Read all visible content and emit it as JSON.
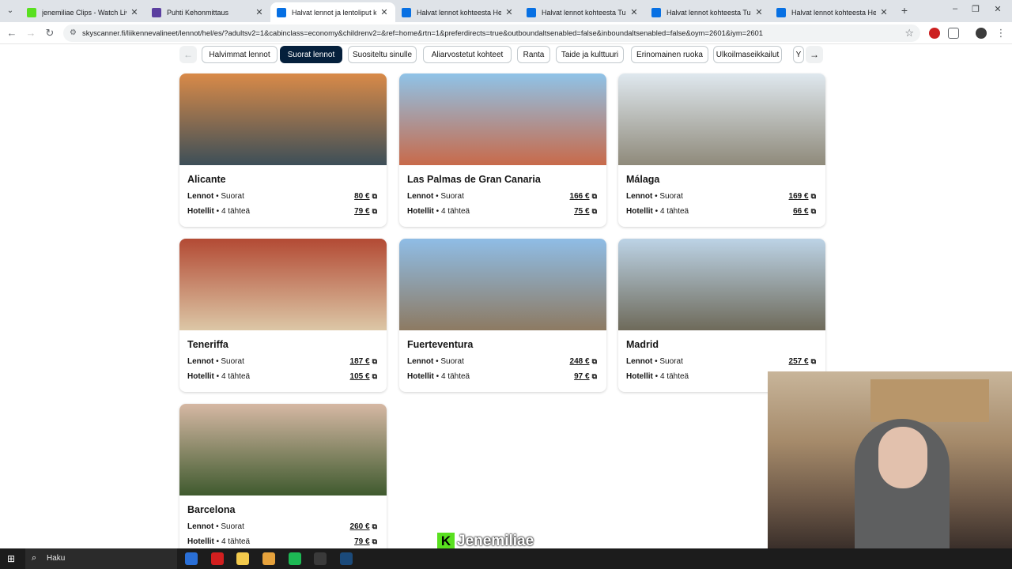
{
  "browser": {
    "tabs": [
      {
        "title": "jenemiliae Clips - Watch Live or",
        "favicon_color": "#59e01f",
        "active": false
      },
      {
        "title": "Puhti Kehonmittaus",
        "favicon_color": "#5b3fa0",
        "active": false
      },
      {
        "title": "Halvat lennot ja lentoliput kaikki",
        "favicon_color": "#0770e3",
        "active": true
      },
      {
        "title": "Halvat lennot kohteesta Helsinki",
        "favicon_color": "#0770e3",
        "active": false
      },
      {
        "title": "Halvat lennot kohteesta Turku (",
        "favicon_color": "#0770e3",
        "active": false
      },
      {
        "title": "Halvat lennot kohteesta Turku (",
        "favicon_color": "#0770e3",
        "active": false
      },
      {
        "title": "Halvat lennot kohteesta Helsinki",
        "favicon_color": "#0770e3",
        "active": false
      }
    ],
    "url": "skyscanner.fi/liikennevalineet/lennot/hel/es/?adultsv2=1&cabinclass=economy&childrenv2=&ref=home&rtn=1&preferdirects=true&outboundaltsenabled=false&inboundaltsenabled=false&oym=2601&iym=2601"
  },
  "filters": {
    "pills": [
      {
        "label": "Halvimmat lennot",
        "active": false
      },
      {
        "label": "Suorat lennot",
        "active": true
      },
      {
        "label": "Suositeltu sinulle",
        "active": false
      },
      {
        "label": "Aliarvostetut kohteet",
        "active": false
      },
      {
        "label": "Ranta",
        "active": false
      },
      {
        "label": "Taide ja kulttuuri",
        "active": false
      },
      {
        "label": "Erinomainen ruoka",
        "active": false
      },
      {
        "label": "Ulkoilmaseikkailut",
        "active": false
      },
      {
        "label": "Y",
        "active": false
      }
    ]
  },
  "common": {
    "flights_label": "Lennot",
    "flights_sub": " • Suorat",
    "hotels_label": "Hotellit",
    "hotels_sub": " • 4 tähteä"
  },
  "destinations": [
    {
      "city": "Alicante",
      "flight_price": "80 €",
      "hotel_price": "79 €",
      "photo_top": "#d98a48",
      "photo_bottom": "#3d4f58"
    },
    {
      "city": "Las Palmas de Gran Canaria",
      "flight_price": "166 €",
      "hotel_price": "75 €",
      "photo_top": "#8fc3e8",
      "photo_bottom": "#c86a4a"
    },
    {
      "city": "Málaga",
      "flight_price": "169 €",
      "hotel_price": "66 €",
      "photo_top": "#dfe8ef",
      "photo_bottom": "#8f8a7b"
    },
    {
      "city": "Teneriffa",
      "flight_price": "187 €",
      "hotel_price": "105 €",
      "photo_top": "#b34a34",
      "photo_bottom": "#dcc7a6"
    },
    {
      "city": "Fuerteventura",
      "flight_price": "248 €",
      "hotel_price": "97 €",
      "photo_top": "#8fbde6",
      "photo_bottom": "#8d7a62"
    },
    {
      "city": "Madrid",
      "flight_price": "257 €",
      "hotel_price": "",
      "photo_top": "#bcd3e6",
      "photo_bottom": "#6e6a5a"
    },
    {
      "city": "Barcelona",
      "flight_price": "260 €",
      "hotel_price": "79 €",
      "photo_top": "#d6b8a4",
      "photo_bottom": "#3f5a2e"
    }
  ],
  "overlay": {
    "watermark_letter": "K",
    "watermark_text": "Jenemiliae"
  },
  "taskbar": {
    "search_label": "Haku",
    "apps": [
      {
        "name": "edge-app-icon",
        "color": "#2a6fd6"
      },
      {
        "name": "l-app-icon",
        "color": "#d21f1f"
      },
      {
        "name": "file-explorer-icon",
        "color": "#f2c94c"
      },
      {
        "name": "chrome-icon",
        "color": "#e6a23c"
      },
      {
        "name": "spotify-icon",
        "color": "#1db954"
      },
      {
        "name": "obs-icon",
        "color": "#3a3a3a"
      },
      {
        "name": "steam-icon",
        "color": "#1b4a7a"
      }
    ]
  }
}
